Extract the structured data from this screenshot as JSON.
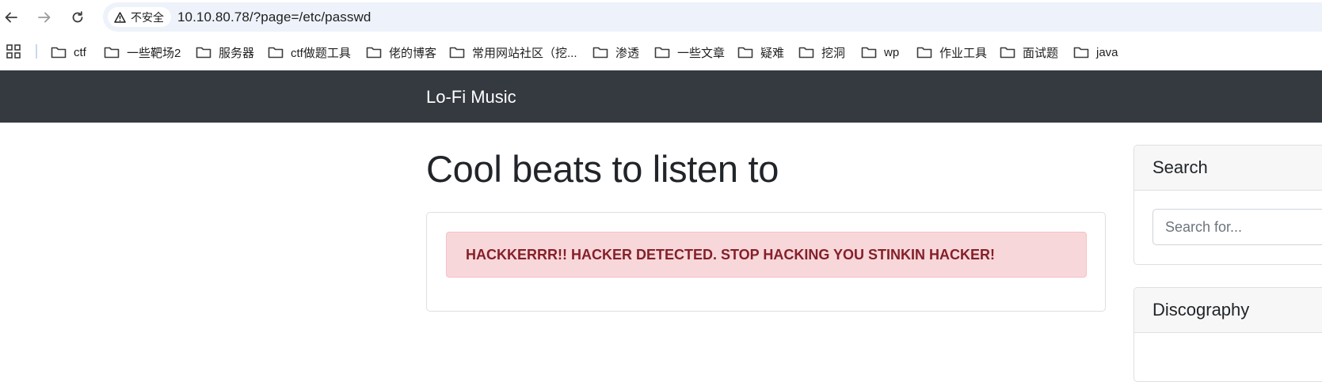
{
  "browser": {
    "security_label": "不安全",
    "url": "10.10.80.78/?page=/etc/passwd"
  },
  "bookmarks": [
    {
      "label": "ctf"
    },
    {
      "label": "一些靶场2"
    },
    {
      "label": "服务器"
    },
    {
      "label": "ctf做题工具"
    },
    {
      "label": "佬的博客"
    },
    {
      "label": "常用网站社区（挖..."
    },
    {
      "label": "渗透"
    },
    {
      "label": "一些文章"
    },
    {
      "label": "疑难"
    },
    {
      "label": "挖洞"
    },
    {
      "label": "wp"
    },
    {
      "label": "作业工具"
    },
    {
      "label": "面试题"
    },
    {
      "label": "java"
    }
  ],
  "navbar": {
    "brand": "Lo-Fi Music"
  },
  "main": {
    "heading": "Cool beats to listen to",
    "alert_text": "HACKKERRR!! HACKER DETECTED. STOP HACKING YOU STINKIN HACKER!"
  },
  "sidebar": {
    "search_title": "Search",
    "search_placeholder": "Search for...",
    "discography_title": "Discography"
  },
  "colors": {
    "navbar_bg": "#343a40",
    "alert_bg": "#f8d7da",
    "alert_text": "#842029",
    "omnibox_bg": "#eef2fa"
  }
}
